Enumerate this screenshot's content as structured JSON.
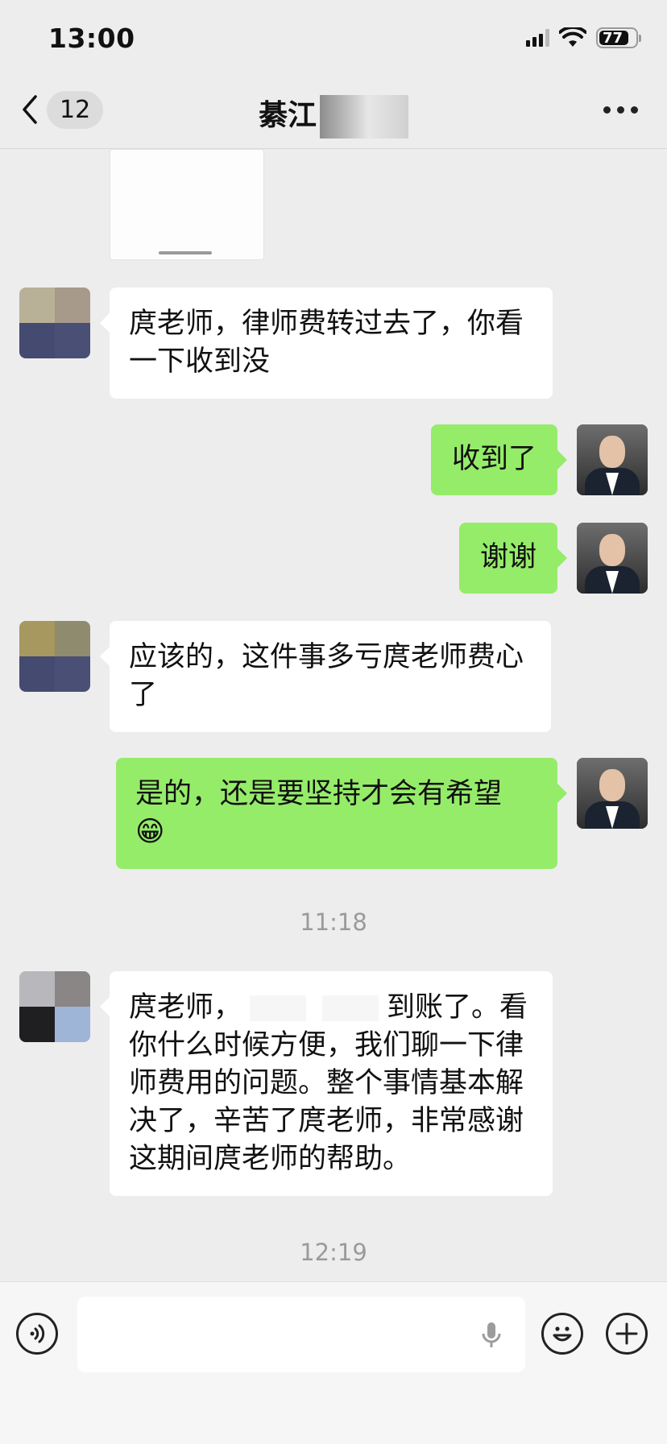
{
  "status_bar": {
    "time": "13:00",
    "battery": "77"
  },
  "nav": {
    "back_count": "12",
    "title": "綦江"
  },
  "messages": [
    {
      "side": "left",
      "text": "庹老师，律师费转过去了，你看一下收到没"
    },
    {
      "side": "right",
      "text": "收到了"
    },
    {
      "side": "right",
      "text": "谢谢"
    },
    {
      "side": "left",
      "text": "应该的，这件事多亏庹老师费心了"
    },
    {
      "side": "right",
      "text": "是的，还是要坚持才会有希望",
      "emoji": "😁"
    },
    {
      "side": "left",
      "text_start": "庹老师，",
      "text_end": "到账了。看你什么时候方便，我们聊一下律师费用的问题。整个事情基本解决了，辛苦了庹老师，非常感谢这期间庹老师的帮助。"
    }
  ],
  "timestamps": {
    "t1": "11:18",
    "t2": "12:19"
  },
  "icons": {
    "back": "chevron-left-icon",
    "more": "more-dots-icon",
    "voice": "voice-icon",
    "mic": "microphone-icon",
    "emoji": "emoji-icon",
    "plus": "plus-icon"
  },
  "colors": {
    "background": "#ededed",
    "sent_bubble": "#95ec69",
    "received_bubble": "#ffffff"
  }
}
